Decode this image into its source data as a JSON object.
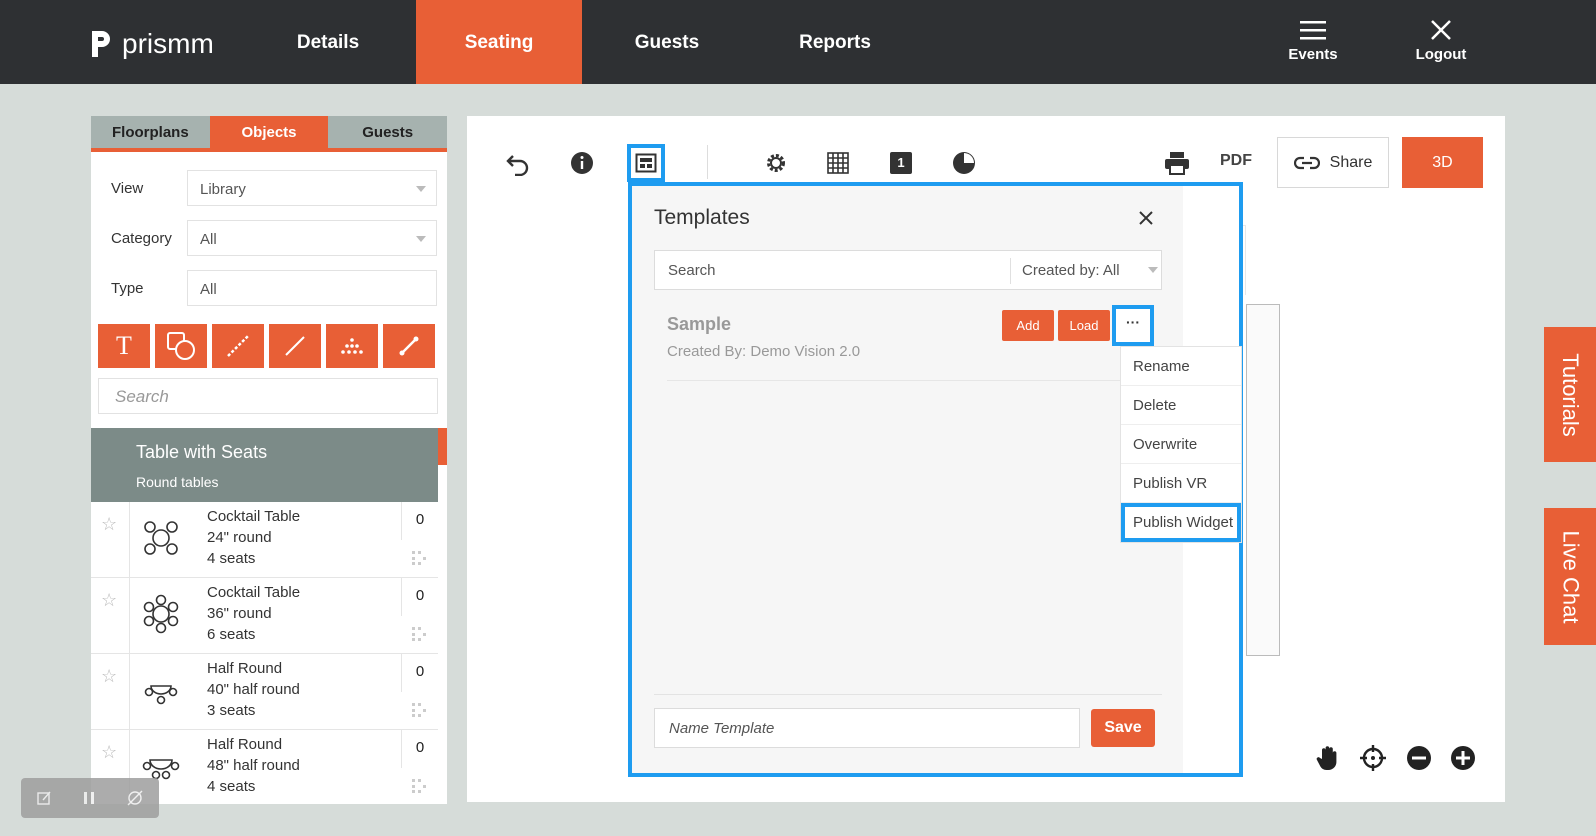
{
  "app": {
    "logo_text": "prismm"
  },
  "nav": {
    "tabs": [
      {
        "label": "Details"
      },
      {
        "label": "Seating"
      },
      {
        "label": "Guests"
      },
      {
        "label": "Reports"
      }
    ],
    "events_label": "Events",
    "logout_label": "Logout"
  },
  "left_panel": {
    "tabs": [
      {
        "label": "Floorplans"
      },
      {
        "label": "Objects"
      },
      {
        "label": "Guests"
      }
    ],
    "filters": {
      "view_label": "View",
      "view_value": "Library",
      "category_label": "Category",
      "category_value": "All",
      "type_label": "Type",
      "type_value": "All"
    },
    "tools": [
      "text-tool-icon",
      "shape-tool-icon",
      "measure-tool-icon",
      "line-tool-icon",
      "grid-seats-icon",
      "wand-tool-icon"
    ],
    "search_placeholder": "Search",
    "group": {
      "title": "Table with Seats",
      "subtitle": "Round tables"
    },
    "items": [
      {
        "name": "Cocktail Table",
        "size": "24\" round",
        "seats": "4 seats",
        "count": "0"
      },
      {
        "name": "Cocktail Table",
        "size": "36\" round",
        "seats": "6 seats",
        "count": "0"
      },
      {
        "name": "Half Round",
        "size": "40\" half round",
        "seats": "3 seats",
        "count": "0"
      },
      {
        "name": "Half Round",
        "size": "48\" half round",
        "seats": "4 seats",
        "count": "0"
      }
    ]
  },
  "toolbar": {
    "pdf_label": "PDF",
    "share_label": "Share",
    "three_d_label": "3D",
    "layer_number": "1"
  },
  "templates_modal": {
    "title": "Templates",
    "search_placeholder": "Search",
    "created_by_label": "Created by:",
    "created_by_value": "All",
    "template": {
      "name": "Sample",
      "created_by": "Created By: Demo Vision 2.0"
    },
    "add_label": "Add",
    "load_label": "Load",
    "more_label": "···",
    "menu": [
      "Rename",
      "Delete",
      "Overwrite",
      "Publish VR",
      "Publish Widget"
    ],
    "name_placeholder": "Name Template",
    "save_label": "Save"
  },
  "side_tabs": {
    "tutorials": "Tutorials",
    "live_chat": "Live Chat"
  },
  "colors": {
    "accent": "#e85f36",
    "highlight": "#1e9cf0",
    "topbar": "#2e3033"
  }
}
